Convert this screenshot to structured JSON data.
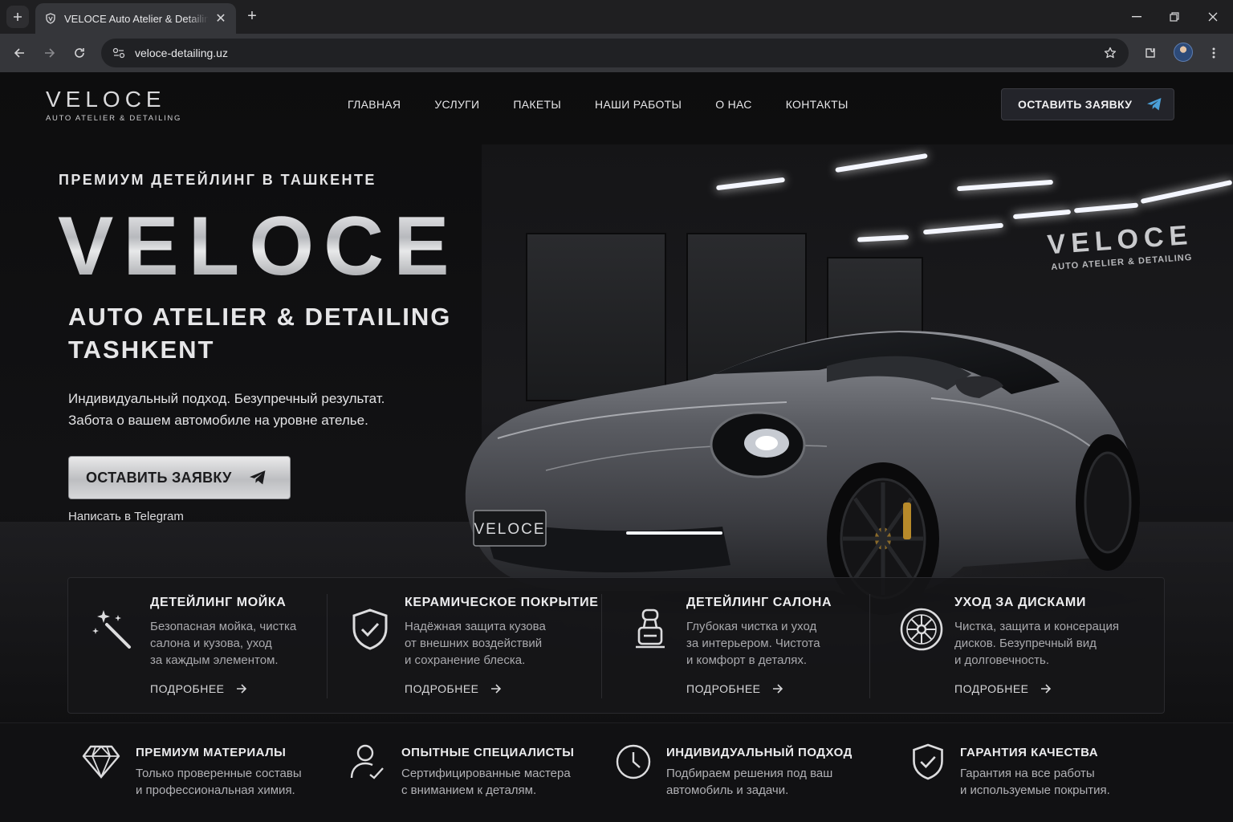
{
  "browser": {
    "tab_title": "VELOCE Auto Atelier & Detailing",
    "url": "veloce-detailing.uz"
  },
  "header": {
    "brand_title": "VELOCE",
    "brand_sub": "AUTO ATELIER & DETAILING",
    "nav": [
      {
        "label": "ГЛАВНАЯ"
      },
      {
        "label": "УСЛУГИ"
      },
      {
        "label": "ПАКЕТЫ"
      },
      {
        "label": "НАШИ РАБОТЫ"
      },
      {
        "label": "О НАС"
      },
      {
        "label": "КОНТАКТЫ"
      }
    ],
    "cta_label": "ОСТАВИТЬ ЗАЯВКУ"
  },
  "hero": {
    "kicker": "ПРЕМИУМ ДЕТЕЙЛИНГ В ТАШКЕНТЕ",
    "title": "VELOCE",
    "sub_line1": "AUTO ATELIER & DETAILING",
    "sub_line2": "TASHKENT",
    "desc_line1": "Индивидуальный подход. Безупречный результат.",
    "desc_line2": "Забота о вашем автомобиле на уровне ателье.",
    "cta_label": "ОСТАВИТЬ ЗАЯВКУ",
    "telegram_link": "Написать в Telegram",
    "wall_logo_title": "VELOCE",
    "wall_logo_sub": "AUTO ATELIER & DETAILING",
    "plate": "VELOCE"
  },
  "services": [
    {
      "title": "ДЕТЕЙЛИНГ МОЙКА",
      "desc": [
        "Безопасная мойка, чистка",
        "салона и кузова, уход",
        "за каждым элементом."
      ],
      "more": "ПОДРОБНЕЕ",
      "icon": "magic-wand-icon"
    },
    {
      "title": "КЕРАМИЧЕСКОЕ ПОКРЫТИЕ",
      "desc": [
        "Надёжная защита кузова",
        "от внешних воздействий",
        "и сохранение блеска."
      ],
      "more": "ПОДРОБНЕЕ",
      "icon": "shield-check-icon"
    },
    {
      "title": "ДЕТЕЙЛИНГ САЛОНА",
      "desc": [
        "Глубокая чистка и уход",
        "за интерьером. Чистота",
        "и комфорт в деталях."
      ],
      "more": "ПОДРОБНЕЕ",
      "icon": "car-seat-icon"
    },
    {
      "title": "УХОД ЗА ДИСКАМИ",
      "desc": [
        "Чистка, защита и консерация",
        "дисков. Безупречный вид",
        "и долговечность."
      ],
      "more": "ПОДРОБНЕЕ",
      "icon": "wheel-icon"
    }
  ],
  "features": [
    {
      "title": "ПРЕМИУМ МАТЕРИАЛЫ",
      "desc": [
        "Только проверенные составы",
        "и профессиональная химия."
      ],
      "icon": "diamond-icon"
    },
    {
      "title": "ОПЫТНЫЕ СПЕЦИАЛИСТЫ",
      "desc": [
        "Сертифицированные мастера",
        "с вниманием к деталям."
      ],
      "icon": "specialist-icon"
    },
    {
      "title": "ИНДИВИДУАЛЬНЫЙ ПОДХОД",
      "desc": [
        "Подбираем решения под ваш",
        "автомобиль и задачи."
      ],
      "icon": "clock-icon"
    },
    {
      "title": "ГАРАНТИЯ КАЧЕСТВА",
      "desc": [
        "Гарантия на все работы",
        "и используемые покрытия."
      ],
      "icon": "shield-check-icon"
    }
  ],
  "colors": {
    "page_bg": "#0b0b0c",
    "accent_telegram": "#4a9fd8",
    "card_bg": "#161618",
    "text_primary": "#ededef",
    "text_muted": "#a9a9ad"
  }
}
